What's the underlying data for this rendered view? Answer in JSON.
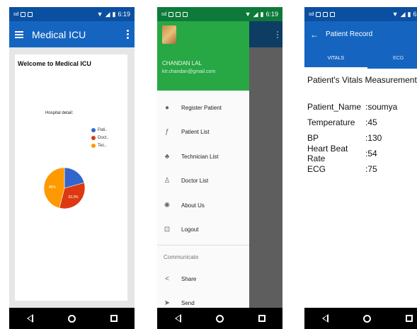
{
  "status_bar": {
    "time": "6:19"
  },
  "screen1": {
    "title": "Medical ICU",
    "welcome": "Welcome to Medical ICU",
    "hospital_detail": "Hospital detail:",
    "legend": [
      {
        "label": "Pati..",
        "color": "#3366cc"
      },
      {
        "label": "Doct..",
        "color": "#dc3912"
      },
      {
        "label": "Tec..",
        "color": "#ff9900"
      }
    ],
    "chart_data": {
      "type": "pie",
      "title": "Hospital detail:",
      "slices": [
        {
          "label": "Pati..",
          "value": 20.7,
          "color": "#3366cc"
        },
        {
          "label": "Doct..",
          "value": 33.3,
          "color": "#dc3912"
        },
        {
          "label": "Tec..",
          "value": 46,
          "color": "#ff9900"
        }
      ],
      "data_labels": [
        "46%",
        "33.3%"
      ]
    }
  },
  "screen2": {
    "user_name": "CHANDAN LAL",
    "user_email": "ktr.chandan@gmail.com",
    "menu_items": [
      {
        "label": "Register Patient",
        "icon": "person-icon"
      },
      {
        "label": "Patient List",
        "icon": "walking-person-icon"
      },
      {
        "label": "Technician List",
        "icon": "technician-icon"
      },
      {
        "label": "Doctor List",
        "icon": "doctor-icon"
      },
      {
        "label": "About Us",
        "icon": "globe-icon"
      },
      {
        "label": "Logout",
        "icon": "logout-icon"
      }
    ],
    "section_label": "Communicate",
    "communicate_items": [
      {
        "label": "Share",
        "icon": "share-icon"
      },
      {
        "label": "Send",
        "icon": "send-icon"
      }
    ]
  },
  "screen3": {
    "title": "Patient Record",
    "tabs": [
      "VITALS",
      "ECG"
    ],
    "heading": "Patient's Vitals Measurements",
    "vitals": [
      {
        "key": "Patient_Name",
        "value": ":soumya"
      },
      {
        "key": "Temperature",
        "value": ":45"
      },
      {
        "key": "BP",
        "value": ":130"
      },
      {
        "key": "Heart Beat Rate",
        "value": ":54"
      },
      {
        "key": "ECG",
        "value": ":75"
      }
    ]
  }
}
